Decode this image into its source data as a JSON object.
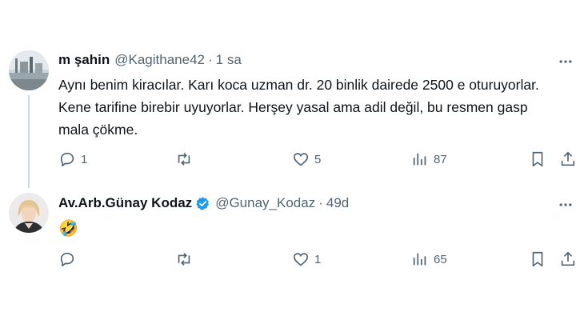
{
  "tweets": [
    {
      "name": "m şahin",
      "handle": "@Kagithane42",
      "dot": "·",
      "time": "1 sa",
      "text": "Aynı benim kiracılar. Karı koca uzman dr. 20 binlik dairede 2500 e oturuyorlar. Kene tarifine birebir uyuyorlar. Herşey yasal ama adil değil, bu resmen gasp mala çökme.",
      "replies": "1",
      "retweets": "",
      "likes": "5",
      "views": "87"
    },
    {
      "name": "Av.Arb.Günay Kodaz",
      "handle": "@Gunay_Kodaz",
      "dot": "·",
      "time": "49d",
      "text": "🤣",
      "replies": "",
      "retweets": "",
      "likes": "1",
      "views": "65"
    }
  ],
  "colors": {
    "text": "#0f1419",
    "secondary": "#536471",
    "verified": "#1d9bf0",
    "thread_line": "#cfd9de"
  }
}
